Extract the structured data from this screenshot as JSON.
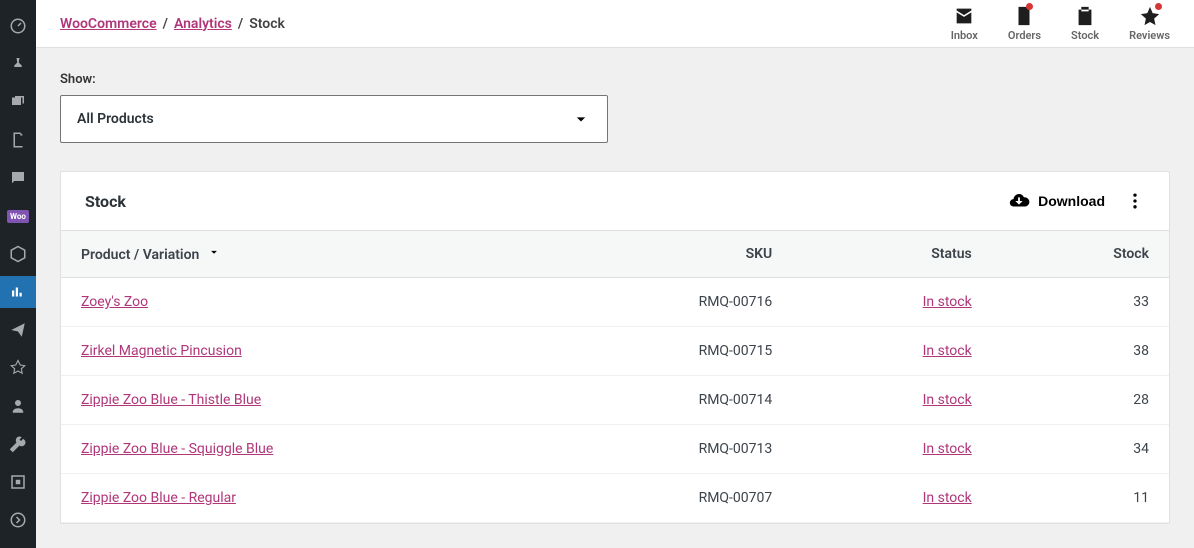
{
  "breadcrumb": {
    "item1": "WooCommerce",
    "item2": "Analytics",
    "current": "Stock"
  },
  "topbar": {
    "inbox": "Inbox",
    "orders": "Orders",
    "stock": "Stock",
    "reviews": "Reviews"
  },
  "filter": {
    "label": "Show:",
    "selected": "All Products"
  },
  "card": {
    "title": "Stock",
    "download": "Download"
  },
  "columns": {
    "product": "Product / Variation",
    "sku": "SKU",
    "status": "Status",
    "stock": "Stock"
  },
  "rows": [
    {
      "product": "Zoey's Zoo",
      "sku": "RMQ-00716",
      "status": "In stock",
      "stock": "33"
    },
    {
      "product": "Zirkel Magnetic Pincusion",
      "sku": "RMQ-00715",
      "status": "In stock",
      "stock": "38"
    },
    {
      "product": "Zippie Zoo Blue - Thistle Blue",
      "sku": "RMQ-00714",
      "status": "In stock",
      "stock": "28"
    },
    {
      "product": "Zippie Zoo Blue - Squiggle Blue",
      "sku": "RMQ-00713",
      "status": "In stock",
      "stock": "34"
    },
    {
      "product": "Zippie Zoo Blue - Regular",
      "sku": "RMQ-00707",
      "status": "In stock",
      "stock": "11"
    }
  ]
}
